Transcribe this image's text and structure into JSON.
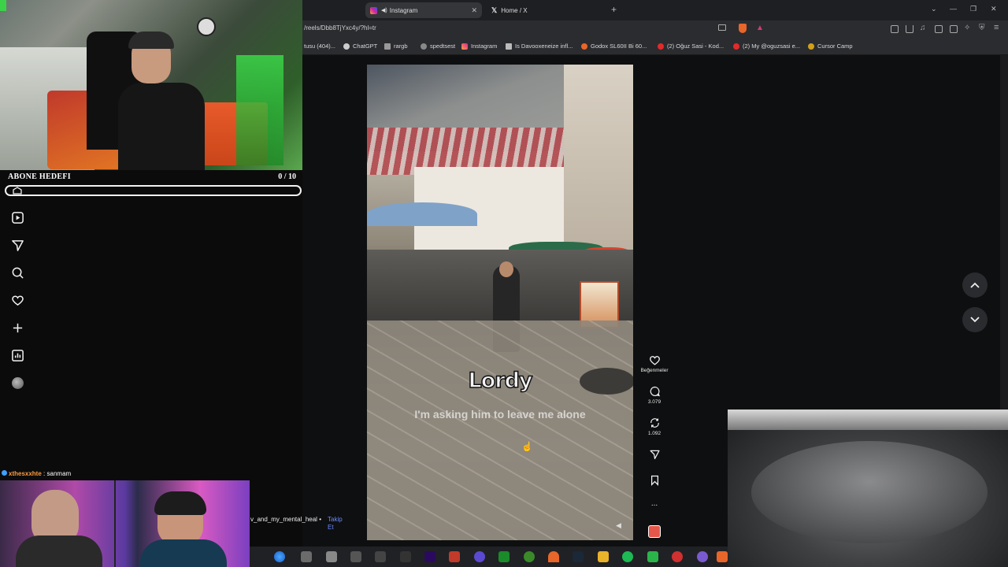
{
  "browser": {
    "tabs": [
      {
        "label": "Instagram",
        "active": true
      },
      {
        "label": "Home / X",
        "active": false
      }
    ],
    "new_tab_symbol": "+",
    "url": "/reels/Dbb8TjYxc4y/?hl=tr",
    "bookmarks": [
      {
        "label": "tusu (404)..."
      },
      {
        "label": "ChatGPT"
      },
      {
        "label": "rargb"
      },
      {
        "label": "spedtsest"
      },
      {
        "label": "Instagram"
      },
      {
        "label": "Is Davooxeneize infl..."
      },
      {
        "label": "Godox SL60II Bi 60..."
      },
      {
        "label": "(2) Oğuz Sasi - Kod..."
      },
      {
        "label": "(2) My @oguzsasi e..."
      },
      {
        "label": "Cursor Camp"
      }
    ]
  },
  "stream_overlay": {
    "goal_label": "ABONE HEDEFI",
    "goal_count": "0 / 10",
    "goal_progress": 0,
    "chat": {
      "user": "xthesxxhte",
      "separator": ":",
      "message": "sanmam"
    }
  },
  "instagram": {
    "nav_icons": [
      "home-icon",
      "reels-icon",
      "send-icon",
      "search-icon",
      "heart-icon",
      "create-icon",
      "dashboard-icon",
      "profile-icon"
    ],
    "reel": {
      "caption_name": "Lordy",
      "caption_sub": "I'm asking him to leave me alone"
    },
    "actions": {
      "like_label": "Beğenmeler",
      "comments_count": "3.079",
      "reposts_count": "1.092",
      "more_symbol": "..."
    },
    "author_username": "v_and_my_mental_heal",
    "author_separator": "•",
    "follow_label": "Takip Et"
  },
  "colors": {
    "page_bg": "#0e0f10",
    "instagram_red": "#e6564a",
    "follow_blue": "#6a8cff",
    "chat_user": "#ff9a3c"
  }
}
